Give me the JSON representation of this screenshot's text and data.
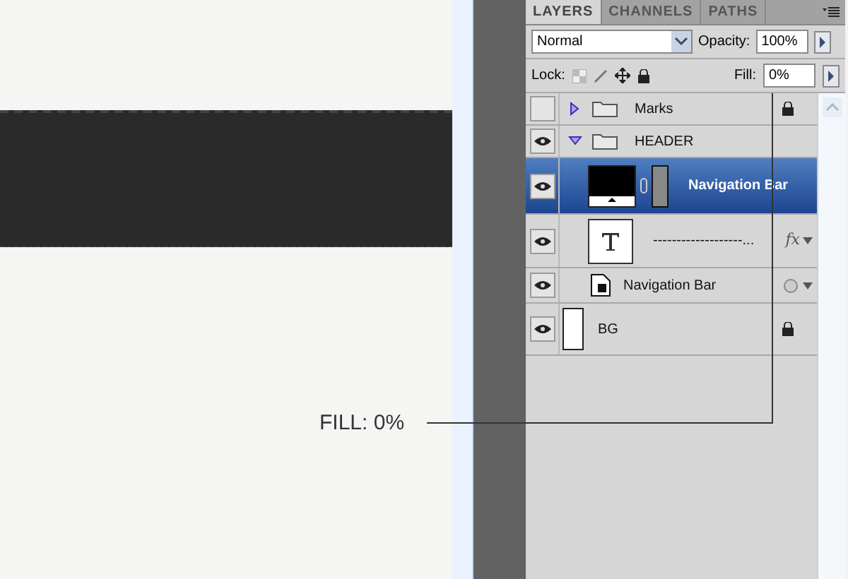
{
  "annotation": {
    "label": "FILL: 0%"
  },
  "panel": {
    "tabs": [
      {
        "label": "LAYERS",
        "selected": true
      },
      {
        "label": "CHANNELS",
        "selected": false
      },
      {
        "label": "PATHS",
        "selected": false
      }
    ],
    "blend_mode": "Normal",
    "opacity_label": "Opacity:",
    "opacity": "100%",
    "lock_label": "Lock:",
    "fill_label": "Fill:",
    "fill": "0%",
    "layers": [
      {
        "kind": "group",
        "name": "Marks",
        "visible": false,
        "expanded": false,
        "locked": true,
        "selected": false
      },
      {
        "kind": "group",
        "name": "HEADER",
        "visible": true,
        "expanded": true,
        "selected": false,
        "children": [
          {
            "kind": "shape",
            "name": "Navigation Bar",
            "visible": true,
            "selected": true
          },
          {
            "kind": "text",
            "name": "-------------------...",
            "visible": true,
            "selected": false,
            "effects_label": "fx"
          },
          {
            "kind": "smart",
            "name": "Navigation Bar",
            "visible": true,
            "selected": false
          }
        ]
      },
      {
        "kind": "background",
        "name": "BG",
        "visible": true,
        "locked": true,
        "selected": false
      }
    ]
  }
}
